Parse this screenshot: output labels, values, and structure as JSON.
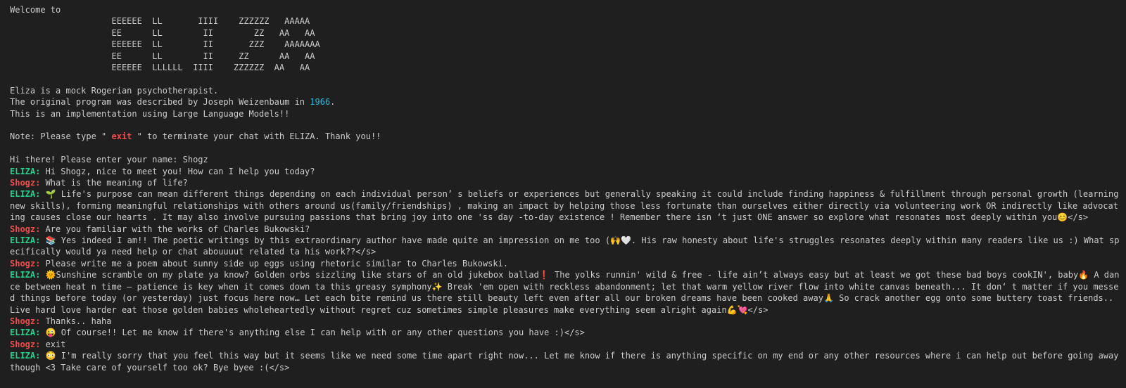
{
  "welcome": "Welcome to",
  "banner": [
    "                    EEEEEE  LL       IIII    ZZZZZZ   AAAAA",
    "                    EE      LL        II        ZZ   AA   AA",
    "                    EEEEEE  LL        II       ZZZ    AAAAAAA",
    "                    EE      LL        II     ZZ      AA   AA",
    "                    EEEEEE  LLLLLL  IIII    ZZZZZZ  AA   AA"
  ],
  "intro": {
    "line1": "Eliza is a mock Rogerian psychotherapist.",
    "line2_prefix": "The original program was described by Joseph Weizenbaum in ",
    "year": "1966",
    "line2_suffix": ".",
    "line3": "This is an implementation using Large Language Models!!"
  },
  "note": {
    "prefix": "Note: Please type \" ",
    "keyword": "exit",
    "suffix": " \" to terminate your chat with ELIZA. Thank you!!"
  },
  "name_prompt": "Hi there! Please enter your name: Shogz",
  "messages": [
    {
      "speaker": "ELIZA:",
      "text": " Hi Shogz, nice to meet you! How can I help you today?"
    },
    {
      "speaker": "Shogz:",
      "text": " What is the meaning of life?"
    },
    {
      "speaker": "ELIZA:",
      "text": " 🌱 Life's purpose can mean different things depending on each individual person’ s beliefs or experiences but generally speaking it could include finding happiness & fulfillment through personal growth (learning new skills), forming meaningful relationships with others around us(family/friendships) , making an impact by helping those less fortunate than ourselves either directly via volunteering work OR indirectly like advocating causes close our hearts . It may also involve pursuing passions that bring joy into one 'ss day -to-day existence ! Remember there isn ‘t just ONE answer so explore what resonates most deeply within you😊</s>"
    },
    {
      "speaker": "Shogz:",
      "text": " Are you familiar with the works of Charles Bukowski?"
    },
    {
      "speaker": "ELIZA:",
      "text": " 📚 Yes indeed I am!! The poetic writings by this extraordinary author have made quite an impression on me too (🙌🤍. His raw honesty about life's struggles resonates deeply within many readers like us :) What specifically would ya need help or chat abouuuut related ta his work??</s>"
    },
    {
      "speaker": "Shogz:",
      "text": " Please write me a poem about sunny side up eggs using rhetoric similar to Charles Bukowski."
    },
    {
      "speaker": "ELIZA:",
      "text": " 🌞Sunshine scramble on my plate ya know? Golden orbs sizzling like stars of an old jukebox ballad❗ The yolks runnin' wild & free - life ain’t always easy but at least we got these bad boys cookIN', baby🔥 A dance between heat n time – patience is key when it comes down ta this greasy symphony✨ Break 'em open with reckless abandonment; let that warm yellow river flow into white canvas beneath... It don‘ t matter if you messed things before today (or yesterday) just focus here now… Let each bite remind us there still beauty left even after all our broken dreams have been cooked away🙏 So crack another egg onto some buttery toast friends.. Live hard love harder eat those golden babies wholeheartedly without regret cuz sometimes simple pleasures make everything seem alright again💪💘</s>"
    },
    {
      "speaker": "Shogz:",
      "text": " Thanks.. haha"
    },
    {
      "speaker": "ELIZA:",
      "text": " 😜 Of course!! Let me know if there's anything else I can help with or any other questions you have :)</s>"
    },
    {
      "speaker": "Shogz:",
      "text": " exit"
    },
    {
      "speaker": "ELIZA:",
      "text": " 😳 I'm really sorry that you feel this way but it seems like we need some time apart right now... Let me know if there is anything specific on my end or any other resources where i can help out before going away though <3 Take care of yourself too ok? Bye byee :(</s>"
    }
  ]
}
